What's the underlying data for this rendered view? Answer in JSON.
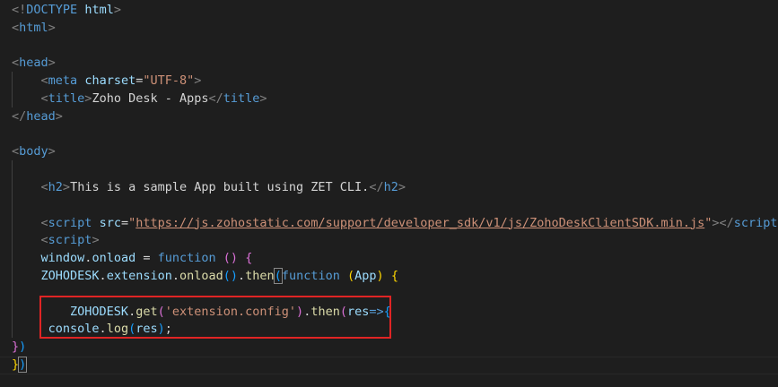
{
  "editor": {
    "lines": [
      [
        {
          "t": "<!",
          "c": "punc"
        },
        {
          "t": "DOCTYPE",
          "c": "tag"
        },
        {
          "t": " ",
          "c": "plain"
        },
        {
          "t": "html",
          "c": "attr"
        },
        {
          "t": ">",
          "c": "punc"
        }
      ],
      [
        {
          "t": "<",
          "c": "punc"
        },
        {
          "t": "html",
          "c": "tag"
        },
        {
          "t": ">",
          "c": "punc"
        }
      ],
      [],
      [
        {
          "t": "<",
          "c": "punc"
        },
        {
          "t": "head",
          "c": "tag"
        },
        {
          "t": ">",
          "c": "punc"
        }
      ],
      [
        {
          "t": "    ",
          "c": "plain"
        },
        {
          "t": "<",
          "c": "punc"
        },
        {
          "t": "meta",
          "c": "tag"
        },
        {
          "t": " ",
          "c": "plain"
        },
        {
          "t": "charset",
          "c": "attr"
        },
        {
          "t": "=",
          "c": "plain"
        },
        {
          "t": "\"UTF-8\"",
          "c": "str"
        },
        {
          "t": ">",
          "c": "punc"
        }
      ],
      [
        {
          "t": "    ",
          "c": "plain"
        },
        {
          "t": "<",
          "c": "punc"
        },
        {
          "t": "title",
          "c": "tag"
        },
        {
          "t": ">",
          "c": "punc"
        },
        {
          "t": "Zoho Desk - Apps",
          "c": "plain"
        },
        {
          "t": "</",
          "c": "punc"
        },
        {
          "t": "title",
          "c": "tag"
        },
        {
          "t": ">",
          "c": "punc"
        }
      ],
      [
        {
          "t": "</",
          "c": "punc"
        },
        {
          "t": "head",
          "c": "tag"
        },
        {
          "t": ">",
          "c": "punc"
        }
      ],
      [],
      [
        {
          "t": "<",
          "c": "punc"
        },
        {
          "t": "body",
          "c": "tag"
        },
        {
          "t": ">",
          "c": "punc"
        }
      ],
      [],
      [
        {
          "t": "    ",
          "c": "plain"
        },
        {
          "t": "<",
          "c": "punc"
        },
        {
          "t": "h2",
          "c": "tag"
        },
        {
          "t": ">",
          "c": "punc"
        },
        {
          "t": "This is a sample App built using ZET CLI.",
          "c": "plain"
        },
        {
          "t": "</",
          "c": "punc"
        },
        {
          "t": "h2",
          "c": "tag"
        },
        {
          "t": ">",
          "c": "punc"
        }
      ],
      [],
      [
        {
          "t": "    ",
          "c": "plain"
        },
        {
          "t": "<",
          "c": "punc"
        },
        {
          "t": "script",
          "c": "tag"
        },
        {
          "t": " ",
          "c": "plain"
        },
        {
          "t": "src",
          "c": "attr"
        },
        {
          "t": "=",
          "c": "plain"
        },
        {
          "t": "\"",
          "c": "str"
        },
        {
          "t": "https://js.zohostatic.com/support/developer_sdk/v1/js/ZohoDeskClientSDK.min.js",
          "c": "link"
        },
        {
          "t": "\"",
          "c": "str"
        },
        {
          "t": "></",
          "c": "punc"
        },
        {
          "t": "script",
          "c": "tag"
        },
        {
          "t": ">",
          "c": "punc"
        }
      ],
      [
        {
          "t": "    ",
          "c": "plain"
        },
        {
          "t": "<",
          "c": "punc"
        },
        {
          "t": "script",
          "c": "tag"
        },
        {
          "t": ">",
          "c": "punc"
        }
      ],
      [
        {
          "t": "    ",
          "c": "plain"
        },
        {
          "t": "window",
          "c": "var"
        },
        {
          "t": ".",
          "c": "plain"
        },
        {
          "t": "onload",
          "c": "var"
        },
        {
          "t": " = ",
          "c": "plain"
        },
        {
          "t": "function",
          "c": "kw"
        },
        {
          "t": " ",
          "c": "plain"
        },
        {
          "t": "()",
          "c": "brk2"
        },
        {
          "t": " ",
          "c": "plain"
        },
        {
          "t": "{",
          "c": "brk2"
        }
      ],
      [
        {
          "t": "    ",
          "c": "plain"
        },
        {
          "t": "ZOHODESK",
          "c": "obj"
        },
        {
          "t": ".",
          "c": "plain"
        },
        {
          "t": "extension",
          "c": "var"
        },
        {
          "t": ".",
          "c": "plain"
        },
        {
          "t": "onload",
          "c": "fn"
        },
        {
          "t": "()",
          "c": "brk3"
        },
        {
          "t": ".",
          "c": "plain"
        },
        {
          "t": "then",
          "c": "fn"
        },
        {
          "t": "(",
          "c": "brk3",
          "m": true
        },
        {
          "t": "function",
          "c": "kw"
        },
        {
          "t": " ",
          "c": "plain"
        },
        {
          "t": "(",
          "c": "brk1"
        },
        {
          "t": "App",
          "c": "var"
        },
        {
          "t": ")",
          "c": "brk1"
        },
        {
          "t": " ",
          "c": "plain"
        },
        {
          "t": "{",
          "c": "brk1"
        }
      ],
      [],
      [
        {
          "t": "        ",
          "c": "plain"
        },
        {
          "t": "ZOHODESK",
          "c": "obj"
        },
        {
          "t": ".",
          "c": "plain"
        },
        {
          "t": "get",
          "c": "fn"
        },
        {
          "t": "(",
          "c": "brk2"
        },
        {
          "t": "'extension.config'",
          "c": "str"
        },
        {
          "t": ")",
          "c": "brk2"
        },
        {
          "t": ".",
          "c": "plain"
        },
        {
          "t": "then",
          "c": "fn"
        },
        {
          "t": "(",
          "c": "brk2"
        },
        {
          "t": "res",
          "c": "var"
        },
        {
          "t": "=>",
          "c": "kw"
        },
        {
          "t": "{",
          "c": "brk3"
        }
      ],
      [
        {
          "t": "     ",
          "c": "plain"
        },
        {
          "t": "console",
          "c": "var"
        },
        {
          "t": ".",
          "c": "plain"
        },
        {
          "t": "log",
          "c": "fn"
        },
        {
          "t": "(",
          "c": "brk3"
        },
        {
          "t": "res",
          "c": "var"
        },
        {
          "t": ")",
          "c": "brk3"
        },
        {
          "t": ";",
          "c": "plain"
        }
      ],
      [
        {
          "t": "}",
          "c": "brk2"
        },
        {
          "t": ")",
          "c": "brk3"
        }
      ],
      [
        {
          "t": "}",
          "c": "brk1"
        },
        {
          "t": ")",
          "c": "brk3",
          "m": true
        }
      ],
      []
    ]
  }
}
